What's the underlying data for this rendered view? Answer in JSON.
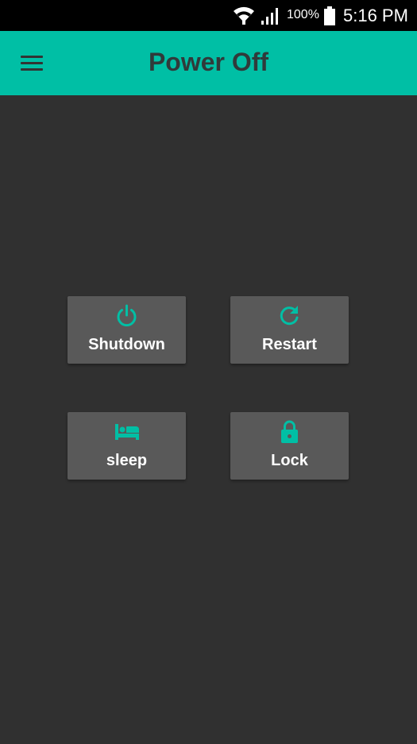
{
  "status_bar": {
    "battery_percent": "100%",
    "time": "5:16 PM",
    "icons": [
      "wifi-icon",
      "signal-icon",
      "battery-icon"
    ]
  },
  "app_bar": {
    "title": "Power Off",
    "menu_icon": "hamburger-menu-icon"
  },
  "actions": [
    {
      "label": "Shutdown",
      "icon": "power-icon"
    },
    {
      "label": "Restart",
      "icon": "refresh-icon"
    },
    {
      "label": "sleep",
      "icon": "bed-icon"
    },
    {
      "label": "Lock",
      "icon": "lock-icon"
    }
  ],
  "colors": {
    "accent": "#00bfa5",
    "background": "#303030",
    "tile": "#595959",
    "title_text": "#303a3a"
  }
}
